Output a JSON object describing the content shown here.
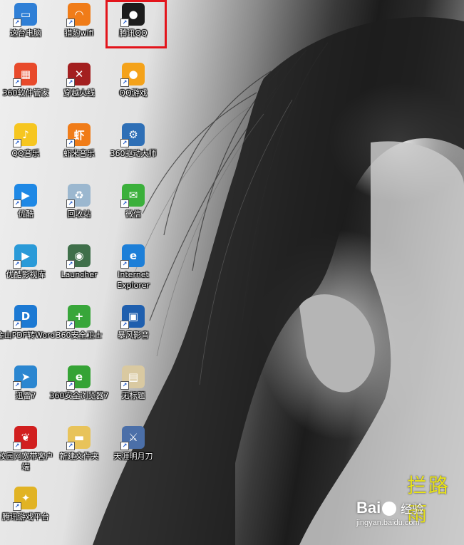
{
  "desktop": {
    "icons": [
      {
        "label": "这台电脑",
        "glyph": "▭",
        "color": "#2f7fd6",
        "icon": "computer-icon"
      },
      {
        "label": "猎豹wifi",
        "glyph": "◠",
        "color": "#f07c18",
        "icon": "wifi-icon"
      },
      {
        "label": "腾讯QQ",
        "glyph": "●",
        "color": "#1c1c1c",
        "icon": "qq-penguin-icon"
      },
      {
        "label": "360软件管家",
        "glyph": "▦",
        "color": "#e84a2b",
        "icon": "360-software-manager-icon"
      },
      {
        "label": "穿越火线",
        "glyph": "✕",
        "color": "#a31f1f",
        "icon": "crossfire-icon"
      },
      {
        "label": "QQ游戏",
        "glyph": "●",
        "color": "#f4a21a",
        "icon": "qq-game-icon"
      },
      {
        "label": "QQ音乐",
        "glyph": "♪",
        "color": "#f6c620",
        "icon": "qq-music-icon"
      },
      {
        "label": "虾米音乐",
        "glyph": "虾",
        "color": "#f07c18",
        "icon": "xiami-music-icon"
      },
      {
        "label": "360驱动大师",
        "glyph": "⚙",
        "color": "#2e6fb6",
        "icon": "driver-master-icon"
      },
      {
        "label": "优酷",
        "glyph": "▶",
        "color": "#1e88e5",
        "icon": "youku-icon"
      },
      {
        "label": "回收站",
        "glyph": "♻",
        "color": "#9bb7cf",
        "icon": "recycle-bin-icon"
      },
      {
        "label": "微信",
        "glyph": "✉",
        "color": "#3bb03b",
        "icon": "wechat-icon"
      },
      {
        "label": "优酷影视库",
        "glyph": "▶",
        "color": "#2a9ad8",
        "icon": "youku-video-library-icon"
      },
      {
        "label": "Launcher",
        "glyph": "◉",
        "color": "#3f6f4a",
        "icon": "launcher-icon"
      },
      {
        "label": "Internet Explorer",
        "glyph": "e",
        "color": "#1d7fd8",
        "icon": "internet-explorer-icon"
      },
      {
        "label": "金山PDF转Word",
        "glyph": "D",
        "color": "#1c79d3",
        "icon": "pdf-to-word-icon"
      },
      {
        "label": "360安全卫士",
        "glyph": "+",
        "color": "#38a63a",
        "icon": "360-security-icon"
      },
      {
        "label": "暴风影音",
        "glyph": "▣",
        "color": "#1f5fae",
        "icon": "baofeng-player-icon"
      },
      {
        "label": "迅雷7",
        "glyph": "➤",
        "color": "#2b86d0",
        "icon": "thunder-icon"
      },
      {
        "label": "360安全浏览器7",
        "glyph": "e",
        "color": "#35a335",
        "icon": "360-browser-icon"
      },
      {
        "label": "无标题",
        "glyph": "▤",
        "color": "#d9c9a1",
        "icon": "untitled-document-icon"
      },
      {
        "label": "校园网宽带客户端",
        "glyph": "❦",
        "color": "#d11f1f",
        "icon": "campus-network-client-icon"
      },
      {
        "label": "新建文件夹",
        "glyph": "▬",
        "color": "#e8c35a",
        "icon": "folder-icon"
      },
      {
        "label": "天涯明月刀",
        "glyph": "⚔",
        "color": "#4b6fa8",
        "icon": "tianya-mingyuedao-icon"
      },
      {
        "label": "腾讯游戏平台",
        "glyph": "✦",
        "color": "#e1b324",
        "icon": "tencent-game-platform-icon"
      }
    ]
  },
  "wallpaper": {
    "calligraphy": "拦路雨"
  },
  "watermark": {
    "logo_left": "Bai",
    "logo_right": "经验",
    "url": "jingyan.baidu.com"
  },
  "colors": {
    "highlight": "#e3141b",
    "calligraphy": "#e8e21a"
  }
}
